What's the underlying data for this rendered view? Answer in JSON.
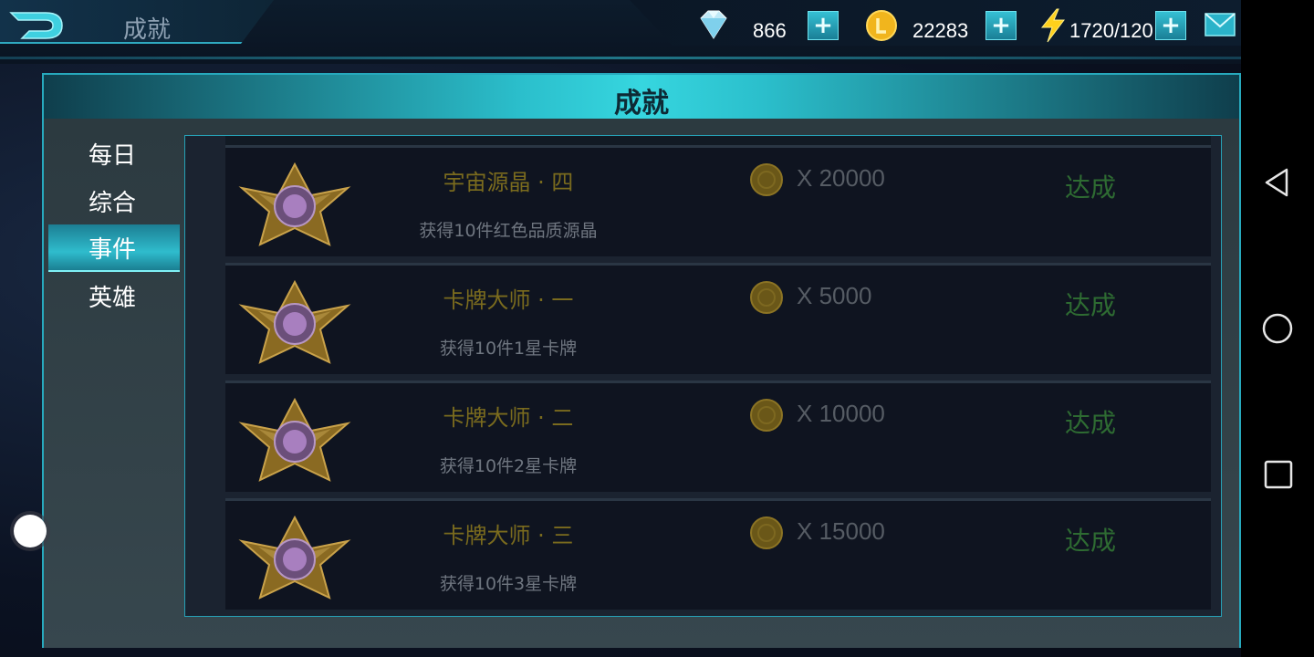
{
  "topbar": {
    "title": "成就",
    "gems": "866",
    "gold": "22283",
    "energy": "1720/120",
    "plus_label": "+"
  },
  "panel": {
    "title": "成就"
  },
  "tabs": [
    {
      "label": "每日",
      "active": false
    },
    {
      "label": "综合",
      "active": false
    },
    {
      "label": "事件",
      "active": true
    },
    {
      "label": "英雄",
      "active": false
    }
  ],
  "achievements": [
    {
      "title": "宇宙源晶 · 四",
      "desc": "获得10件红色品质源晶",
      "reward": "X 20000",
      "status": "达成"
    },
    {
      "title": "卡牌大师 · 一",
      "desc": "获得10件1星卡牌",
      "reward": "X 5000",
      "status": "达成"
    },
    {
      "title": "卡牌大师 · 二",
      "desc": "获得10件2星卡牌",
      "reward": "X 10000",
      "status": "达成"
    },
    {
      "title": "卡牌大师 · 三",
      "desc": "获得10件3星卡牌",
      "reward": "X 15000",
      "status": "达成"
    }
  ],
  "icons": {
    "back": "back-arrow-icon",
    "gem": "diamond-icon",
    "coin": "gold-coin-icon",
    "energy": "lightning-icon",
    "mail": "mail-icon",
    "medal": "star-medal-icon",
    "nav_back": "triangle-back-icon",
    "nav_home": "circle-home-icon",
    "nav_recent": "square-recent-icon"
  },
  "colors": {
    "accent": "#2fbccd",
    "achievement_title": "#7a6b1e",
    "achieved_status": "#2e6b32"
  }
}
